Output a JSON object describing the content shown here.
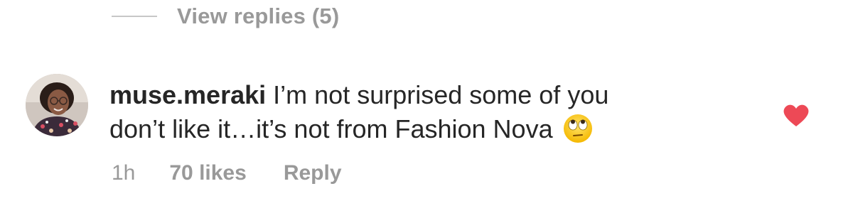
{
  "replies": {
    "label": "View replies (5)"
  },
  "comment": {
    "username": "muse.meraki",
    "text_line1": "I’m not surprised some of you",
    "text_line2": "don’t like it…it’s not from Fashion Nova",
    "emoji": "face-with-rolling-eyes-emoji",
    "liked": true,
    "heart_color": "#ed4956"
  },
  "meta": {
    "time": "1h",
    "likes": "70 likes",
    "reply": "Reply"
  },
  "colors": {
    "text": "#262626",
    "secondary": "#999999",
    "divider": "#c7c7c7"
  }
}
